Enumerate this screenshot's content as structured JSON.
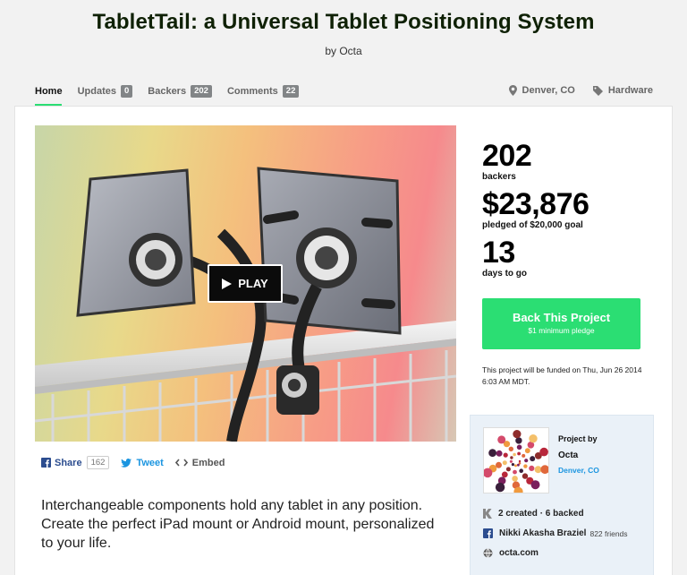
{
  "project": {
    "title": "TabletTail: a Universal Tablet Positioning System",
    "byline": "by Octa"
  },
  "nav": {
    "home": "Home",
    "updates": "Updates",
    "updates_count": "0",
    "backers": "Backers",
    "backers_count": "202",
    "comments": "Comments",
    "comments_count": "22",
    "location": "Denver, CO",
    "category": "Hardware"
  },
  "video": {
    "play_label": "PLAY"
  },
  "share": {
    "facebook_label": "Share",
    "facebook_count": "162",
    "tweet_label": "Tweet",
    "embed_label": "Embed"
  },
  "blurb": "Interchangeable components hold any tablet in any position. Create the perfect iPad mount or Android mount, personalized to your life.",
  "stats": {
    "backers_num": "202",
    "backers_label": "backers",
    "pledged_num": "$23,876",
    "pledged_label": "pledged of $20,000 goal",
    "days_num": "13",
    "days_label": "days to go"
  },
  "cta": {
    "label": "Back This Project",
    "sublabel": "$1 minimum pledge"
  },
  "funding_note": "This project will be funded on Thu, Jun 26 2014 6:03 AM MDT.",
  "creator": {
    "project_by": "Project by",
    "name": "Octa",
    "location": "Denver, CO",
    "created_backed": "2 created · 6 backed",
    "facebook_name": "Nikki Akasha Braziel",
    "friends": "822 friends",
    "website": "octa.com"
  },
  "colors": {
    "accent": "#2bde73",
    "nav_badge": "#828587",
    "creator_bg": "#eaf1f8",
    "facebook": "#2c4d8f",
    "twitter": "#1b95e0"
  },
  "icons": [
    "location-pin-icon",
    "tag-icon",
    "play-icon",
    "facebook-icon",
    "twitter-icon",
    "embed-icon",
    "kickstarter-k-icon",
    "globe-icon"
  ]
}
